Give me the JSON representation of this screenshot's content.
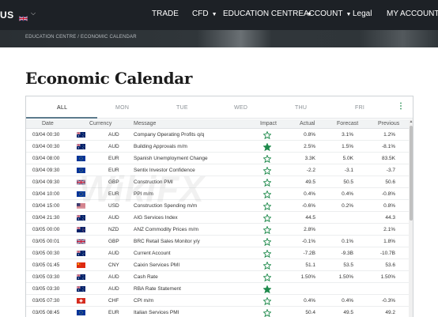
{
  "nav": {
    "logo_fragment": "US",
    "language_flag": "uk-flag-icon",
    "items": [
      {
        "label": "TRADE",
        "has_caret": false
      },
      {
        "label": "CFD",
        "has_caret": true
      },
      {
        "label": "EDUCATION CENTRE",
        "has_caret": true
      },
      {
        "label": "ACCOUNT",
        "has_caret": true
      },
      {
        "label": "Legal",
        "has_caret": false
      },
      {
        "label": "MY ACCOUNT",
        "has_caret": false
      }
    ]
  },
  "breadcrumb": "EDUCATION CENTRE / ECONOMIC CALENDAR",
  "page_title": "Economic Calendar",
  "tabs": [
    "ALL",
    "MON",
    "TUE",
    "WED",
    "THU",
    "FRI"
  ],
  "active_tab": "ALL",
  "columns": {
    "date": "Date",
    "currency": "Currency",
    "message": "Message",
    "impact": "Impact",
    "actual": "Actual",
    "forecast": "Forecast",
    "previous": "Previous"
  },
  "rows": [
    {
      "date": "03/04 00:30",
      "flag": "au",
      "currency": "AUD",
      "message": "Company Operating Profits q/q",
      "impact": "low",
      "actual": "0.8%",
      "forecast": "3.1%",
      "previous": "1.2%"
    },
    {
      "date": "03/04 00:30",
      "flag": "au",
      "currency": "AUD",
      "message": "Building Approvals m/m",
      "impact": "high",
      "actual": "2.5%",
      "forecast": "1.5%",
      "previous": "-8.1%"
    },
    {
      "date": "03/04 08:00",
      "flag": "eu",
      "currency": "EUR",
      "message": "Spanish Unemployment Change",
      "impact": "low",
      "actual": "3.3K",
      "forecast": "5.0K",
      "previous": "83.5K"
    },
    {
      "date": "03/04 09:30",
      "flag": "eu",
      "currency": "EUR",
      "message": "Sentix Investor Confidence",
      "impact": "low",
      "actual": "-2.2",
      "forecast": "-3.1",
      "previous": "-3.7"
    },
    {
      "date": "03/04 09:30",
      "flag": "uk",
      "currency": "GBP",
      "message": "Construction PMI",
      "impact": "low",
      "actual": "49.5",
      "forecast": "50.5",
      "previous": "50.6"
    },
    {
      "date": "03/04 10:00",
      "flag": "eu",
      "currency": "EUR",
      "message": "PPI m/m",
      "impact": "low",
      "actual": "0.4%",
      "forecast": "0.4%",
      "previous": "-0.8%"
    },
    {
      "date": "03/04 15:00",
      "flag": "us",
      "currency": "USD",
      "message": "Construction Spending m/m",
      "impact": "low",
      "actual": "-0.6%",
      "forecast": "0.2%",
      "previous": "0.8%"
    },
    {
      "date": "03/04 21:30",
      "flag": "au",
      "currency": "AUD",
      "message": "AIG Services Index",
      "impact": "low",
      "actual": "44.5",
      "forecast": "",
      "previous": "44.3"
    },
    {
      "date": "03/05 00:00",
      "flag": "nz",
      "currency": "NZD",
      "message": "ANZ Commodity Prices m/m",
      "impact": "low",
      "actual": "2.8%",
      "forecast": "",
      "previous": "2.1%"
    },
    {
      "date": "03/05 00:01",
      "flag": "uk",
      "currency": "GBP",
      "message": "BRC Retail Sales Monitor y/y",
      "impact": "low",
      "actual": "-0.1%",
      "forecast": "0.1%",
      "previous": "1.8%"
    },
    {
      "date": "03/05 00:30",
      "flag": "au",
      "currency": "AUD",
      "message": "Current Account",
      "impact": "low",
      "actual": "-7.2B",
      "forecast": "-9.3B",
      "previous": "-10.7B"
    },
    {
      "date": "03/05 01:45",
      "flag": "cn",
      "currency": "CNY",
      "message": "Caixin Services PMI",
      "impact": "low",
      "actual": "51.1",
      "forecast": "53.5",
      "previous": "53.6"
    },
    {
      "date": "03/05 03:30",
      "flag": "au",
      "currency": "AUD",
      "message": "Cash Rate",
      "impact": "low",
      "actual": "1.50%",
      "forecast": "1.50%",
      "previous": "1.50%"
    },
    {
      "date": "03/05 03:30",
      "flag": "au",
      "currency": "AUD",
      "message": "RBA Rate Statement",
      "impact": "high",
      "actual": "",
      "forecast": "",
      "previous": ""
    },
    {
      "date": "03/05 07:30",
      "flag": "ch",
      "currency": "CHF",
      "message": "CPI m/m",
      "impact": "low",
      "actual": "0.4%",
      "forecast": "0.4%",
      "previous": "-0.3%"
    },
    {
      "date": "03/05 08:45",
      "flag": "eu",
      "currency": "EUR",
      "message": "Italian Services PMI",
      "impact": "low",
      "actual": "50.4",
      "forecast": "49.5",
      "previous": "49.2"
    }
  ],
  "watermark": "WikiFX",
  "colors": {
    "nav_bg": "#1d2126",
    "impact_green": "#1f8a4c",
    "tab_underline": "#5c7a8c"
  }
}
